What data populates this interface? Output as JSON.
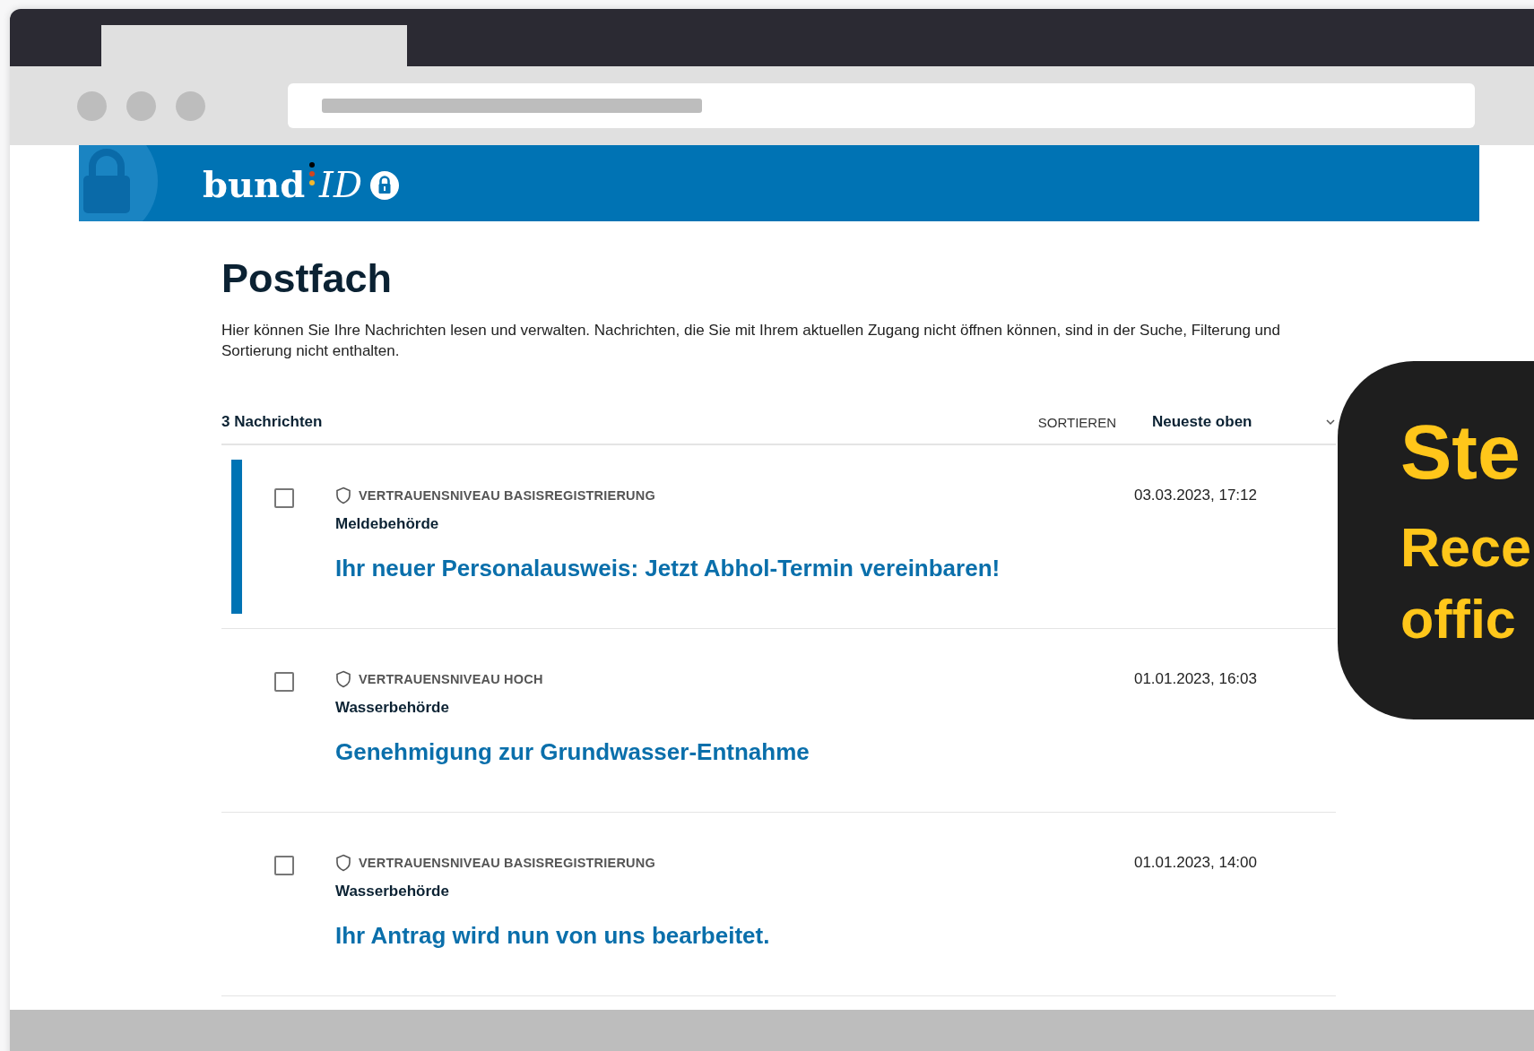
{
  "brand": {
    "word": "bund",
    "suffix": "ID"
  },
  "page": {
    "title": "Postfach",
    "description": "Hier können Sie Ihre Nachrichten lesen und verwalten. Nachrichten, die Sie mit Ihrem aktuellen Zugang nicht öffnen können, sind in der Suche, Filterung und Sortierung nicht enthalten."
  },
  "toolbar": {
    "count": "3 Nachrichten",
    "sort_label": "SORTIEREN",
    "sort_value": "Neueste oben"
  },
  "messages": [
    {
      "trust": "VERTRAUENSNIVEAU BASISREGISTRIERUNG",
      "sender": "Meldebehörde",
      "subject": "Ihr neuer Personalausweis: Jetzt Abhol-Termin vereinbaren!",
      "date": "03.03.2023, 17:12",
      "unread": true,
      "checked": false
    },
    {
      "trust": "VERTRAUENSNIVEAU HOCH",
      "sender": "Wasserbehörde",
      "subject": "Genehmigung zur Grundwasser-Entnahme",
      "date": "01.01.2023, 16:03",
      "unread": false,
      "checked": false
    },
    {
      "trust": "VERTRAUENSNIVEAU BASISREGISTRIERUNG",
      "sender": "Wasserbehörde",
      "subject": "Ihr Antrag wird nun von uns bearbeitet.",
      "date": "01.01.2023, 14:00",
      "unread": false,
      "checked": false
    }
  ],
  "callout": {
    "heading": "Ste",
    "lines": [
      "Rece",
      "offic"
    ]
  }
}
